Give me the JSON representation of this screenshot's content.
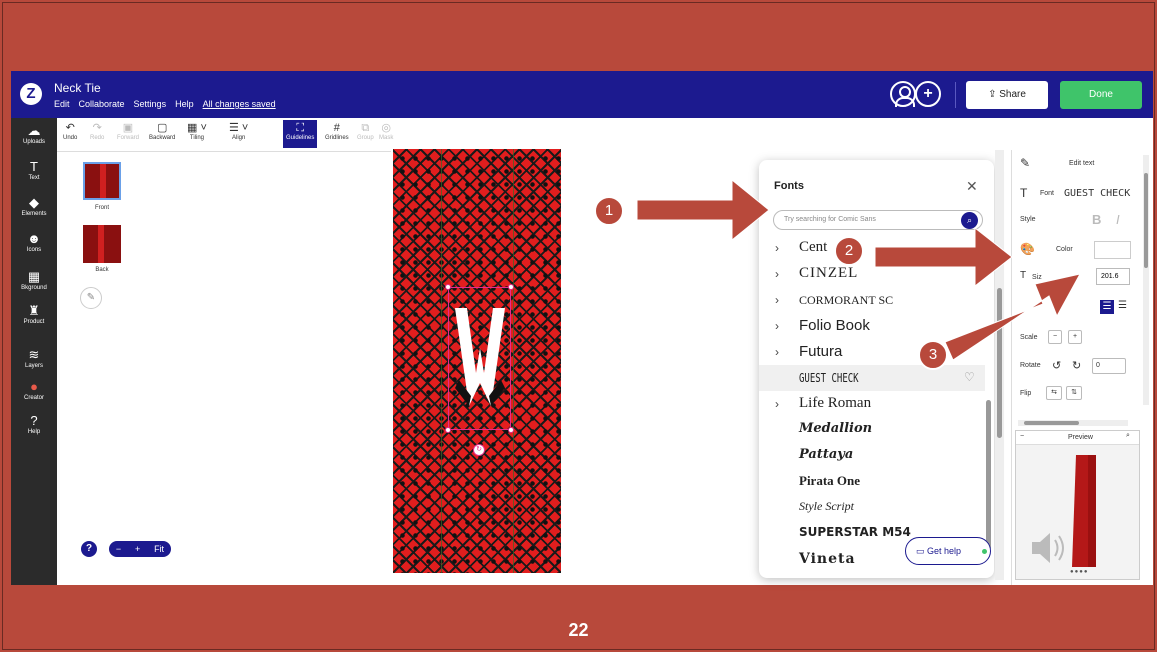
{
  "slide": {
    "number": "22"
  },
  "app": {
    "title": "Neck Tie",
    "menu": [
      "Edit",
      "Collaborate",
      "Settings",
      "Help"
    ],
    "save_status": "All changes saved",
    "share_label": "Share",
    "done_label": "Done"
  },
  "nav": {
    "items": [
      {
        "label": "Uploads",
        "icon": "cloud-upload-icon"
      },
      {
        "label": "Text",
        "icon": "text-icon"
      },
      {
        "label": "Elements",
        "icon": "elements-icon"
      },
      {
        "label": "Icons",
        "icon": "smile-icon"
      },
      {
        "label": "Bkground",
        "icon": "background-icon"
      },
      {
        "label": "Product",
        "icon": "product-icon"
      },
      {
        "label": "Layers",
        "icon": "layers-icon"
      },
      {
        "label": "Creator",
        "icon": "creator-icon"
      },
      {
        "label": "Help",
        "icon": "help-icon"
      }
    ]
  },
  "toolbar": {
    "tools": [
      {
        "label": "Undo",
        "state": "enabled"
      },
      {
        "label": "Redo",
        "state": "disabled"
      },
      {
        "label": "Forward",
        "state": "disabled"
      },
      {
        "label": "Backward",
        "state": "enabled"
      },
      {
        "label": "Tiling",
        "state": "enabled"
      },
      {
        "label": "Align",
        "state": "enabled"
      },
      {
        "label": "Guidelines",
        "state": "active"
      },
      {
        "label": "Gridlines",
        "state": "enabled"
      },
      {
        "label": "Group",
        "state": "disabled"
      },
      {
        "label": "Mask",
        "state": "disabled"
      }
    ]
  },
  "pages": {
    "front_label": "Front",
    "back_label": "Back",
    "zoom_fit": "Fit"
  },
  "canvas": {
    "selected_text": "W"
  },
  "fonts_panel": {
    "title": "Fonts",
    "search_placeholder": "Try searching for Comic Sans",
    "items": [
      {
        "name": "Cent",
        "expandable": true
      },
      {
        "name": "CINZEL",
        "expandable": true
      },
      {
        "name": "CORMORANT SC",
        "expandable": true
      },
      {
        "name": "Folio Book",
        "expandable": true
      },
      {
        "name": "Futura",
        "expandable": true
      },
      {
        "name": "GUEST CHECK",
        "expandable": false,
        "hovered": true
      },
      {
        "name": "Life Roman",
        "expandable": true
      },
      {
        "name": "Medallion",
        "expandable": false
      },
      {
        "name": "Pattaya",
        "expandable": false
      },
      {
        "name": "Pirata One",
        "expandable": false
      },
      {
        "name": "Style Script",
        "expandable": false
      },
      {
        "name": "SUPERSTAR M54",
        "expandable": false
      },
      {
        "name": "Vineta",
        "expandable": false
      }
    ],
    "get_help": "Get help"
  },
  "properties": {
    "edit_text": "Edit text",
    "font_label": "Font",
    "font_value": "GUEST CHECK",
    "style_label": "Style",
    "color_label": "Color",
    "size_label": "Siz",
    "size_value": "201.6",
    "scale_label": "Scale",
    "rotate_label": "Rotate",
    "rotate_value": "0",
    "flip_label": "Flip",
    "preview_label": "Preview"
  },
  "callouts": [
    "1",
    "2",
    "3"
  ],
  "colors": {
    "slide_bg": "#b8493b",
    "topbar": "#1c1a8f",
    "done": "#3fc46a",
    "tie_red": "#e11e1e"
  }
}
